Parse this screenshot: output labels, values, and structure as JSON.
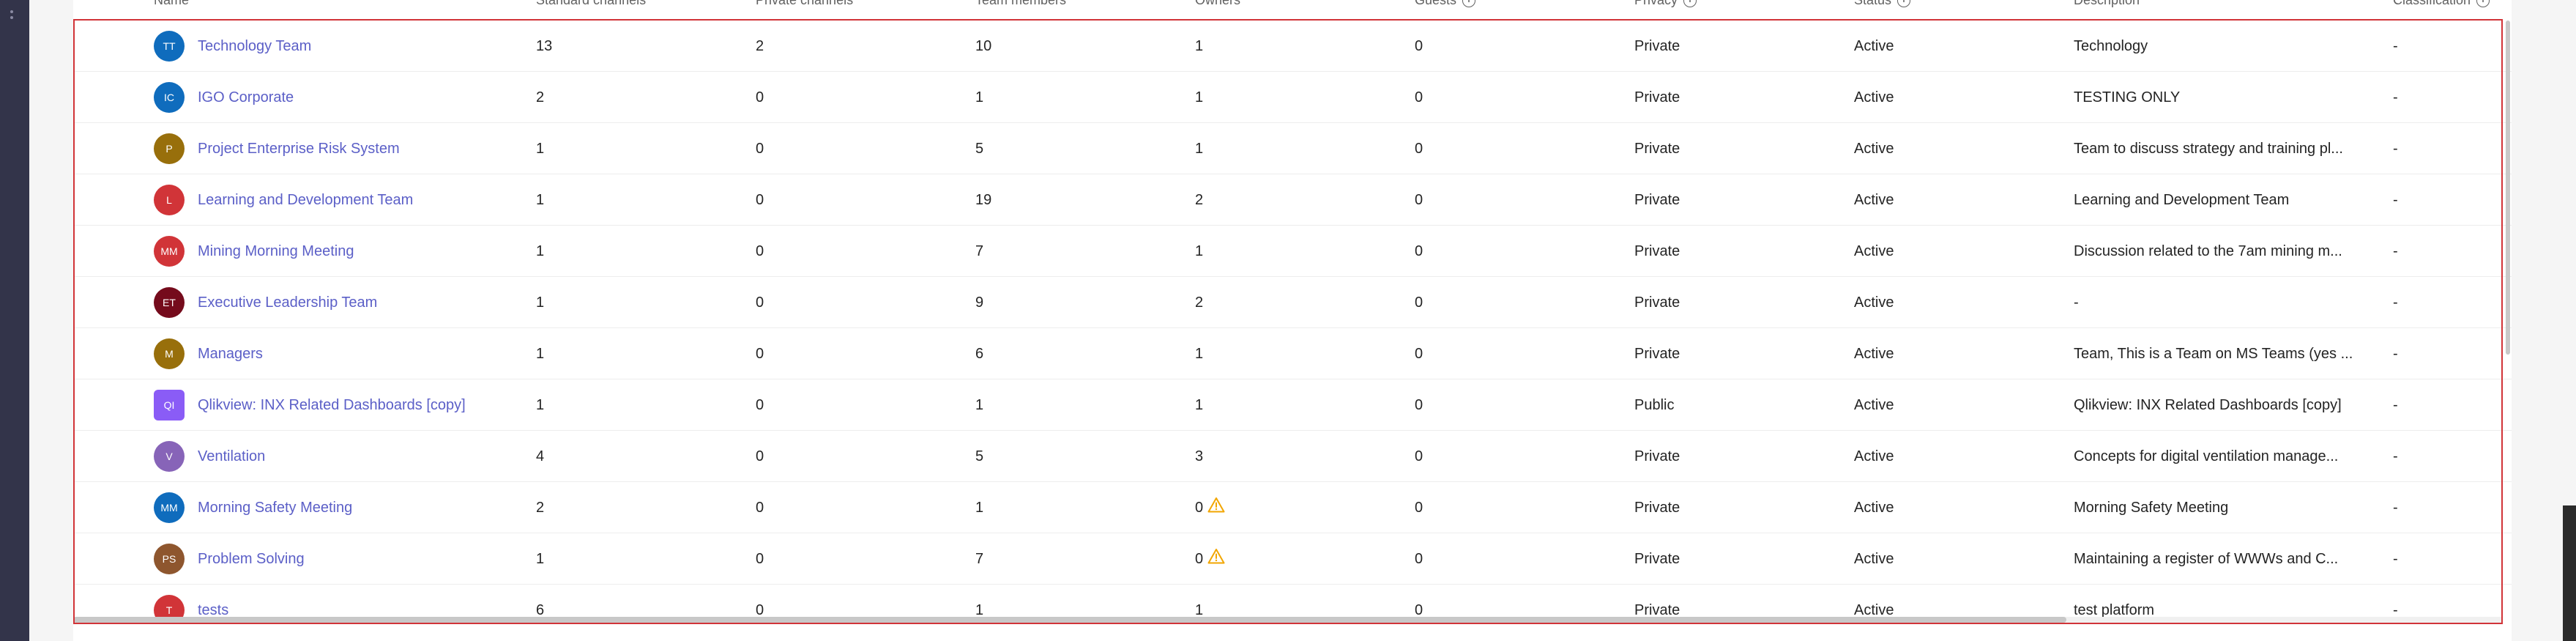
{
  "table": {
    "headers": {
      "name": "Name",
      "standard_channels": "Standard channels",
      "private_channels": "Private channels",
      "team_members": "Team members",
      "owners": "Owners",
      "guests": "Guests",
      "privacy": "Privacy",
      "status": "Status",
      "description": "Description",
      "classification": "Classification"
    },
    "rows": [
      {
        "initials": "TT",
        "avatar_color": "#0f6cbd",
        "name": "Technology Team",
        "standard_channels": "13",
        "private_channels": "2",
        "team_members": "10",
        "owners": "1",
        "owners_warning": false,
        "guests": "0",
        "privacy": "Private",
        "status": "Active",
        "description": "Technology",
        "classification": "-"
      },
      {
        "initials": "IC",
        "avatar_color": "#0f6cbd",
        "name": "IGO Corporate",
        "standard_channels": "2",
        "private_channels": "0",
        "team_members": "1",
        "owners": "1",
        "owners_warning": false,
        "guests": "0",
        "privacy": "Private",
        "status": "Active",
        "description": "TESTING ONLY",
        "classification": "-"
      },
      {
        "initials": "P",
        "avatar_color": "#986f0b",
        "name": "Project Enterprise Risk System",
        "standard_channels": "1",
        "private_channels": "0",
        "team_members": "5",
        "owners": "1",
        "owners_warning": false,
        "guests": "0",
        "privacy": "Private",
        "status": "Active",
        "description": "Team to discuss strategy and training pl...",
        "classification": "-"
      },
      {
        "initials": "L",
        "avatar_color": "#d13438",
        "name": "Learning and Development Team",
        "standard_channels": "1",
        "private_channels": "0",
        "team_members": "19",
        "owners": "2",
        "owners_warning": false,
        "guests": "0",
        "privacy": "Private",
        "status": "Active",
        "description": "Learning and Development Team",
        "classification": "-"
      },
      {
        "initials": "MM",
        "avatar_color": "#d13438",
        "name": "Mining Morning Meeting",
        "standard_channels": "1",
        "private_channels": "0",
        "team_members": "7",
        "owners": "1",
        "owners_warning": false,
        "guests": "0",
        "privacy": "Private",
        "status": "Active",
        "description": "Discussion related to the 7am mining m...",
        "classification": "-"
      },
      {
        "initials": "ET",
        "avatar_color": "#750b1c",
        "name": "Executive Leadership Team",
        "standard_channels": "1",
        "private_channels": "0",
        "team_members": "9",
        "owners": "2",
        "owners_warning": false,
        "guests": "0",
        "privacy": "Private",
        "status": "Active",
        "description": "-",
        "classification": "-"
      },
      {
        "initials": "M",
        "avatar_color": "#986f0b",
        "name": "Managers",
        "standard_channels": "1",
        "private_channels": "0",
        "team_members": "6",
        "owners": "1",
        "owners_warning": false,
        "guests": "0",
        "privacy": "Private",
        "status": "Active",
        "description": "Team, This is a Team on MS Teams (yes ...",
        "classification": "-"
      },
      {
        "initials": "QI",
        "avatar_color": "#8a5cf6",
        "avatar_square": true,
        "name": "Qlikview: INX Related Dashboards [copy]",
        "standard_channels": "1",
        "private_channels": "0",
        "team_members": "1",
        "owners": "1",
        "owners_warning": false,
        "guests": "0",
        "privacy": "Public",
        "status": "Active",
        "description": "Qlikview: INX Related Dashboards [copy]",
        "classification": "-"
      },
      {
        "initials": "V",
        "avatar_color": "#8764b8",
        "name": "Ventilation",
        "standard_channels": "4",
        "private_channels": "0",
        "team_members": "5",
        "owners": "3",
        "owners_warning": false,
        "guests": "0",
        "privacy": "Private",
        "status": "Active",
        "description": "Concepts for digital ventilation manage...",
        "classification": "-"
      },
      {
        "initials": "MM",
        "avatar_color": "#0f6cbd",
        "name": "Morning Safety Meeting",
        "standard_channels": "2",
        "private_channels": "0",
        "team_members": "1",
        "owners": "0",
        "owners_warning": true,
        "guests": "0",
        "privacy": "Private",
        "status": "Active",
        "description": "Morning Safety Meeting",
        "classification": "-"
      },
      {
        "initials": "PS",
        "avatar_color": "#8e562e",
        "name": "Problem Solving",
        "standard_channels": "1",
        "private_channels": "0",
        "team_members": "7",
        "owners": "0",
        "owners_warning": true,
        "guests": "0",
        "privacy": "Private",
        "status": "Active",
        "description": "Maintaining a register of WWWs and C...",
        "classification": "-"
      },
      {
        "initials": "T",
        "avatar_color": "#d13438",
        "name": "tests",
        "standard_channels": "6",
        "private_channels": "0",
        "team_members": "1",
        "owners": "1",
        "owners_warning": false,
        "guests": "0",
        "privacy": "Private",
        "status": "Active",
        "description": "test platform",
        "classification": "-"
      }
    ]
  },
  "icons": {
    "info": "info-icon",
    "warning": "warning-icon"
  },
  "colors": {
    "accent": "#5b5fc7",
    "selection_outline": "#d13438",
    "warning": "#f2a600"
  }
}
